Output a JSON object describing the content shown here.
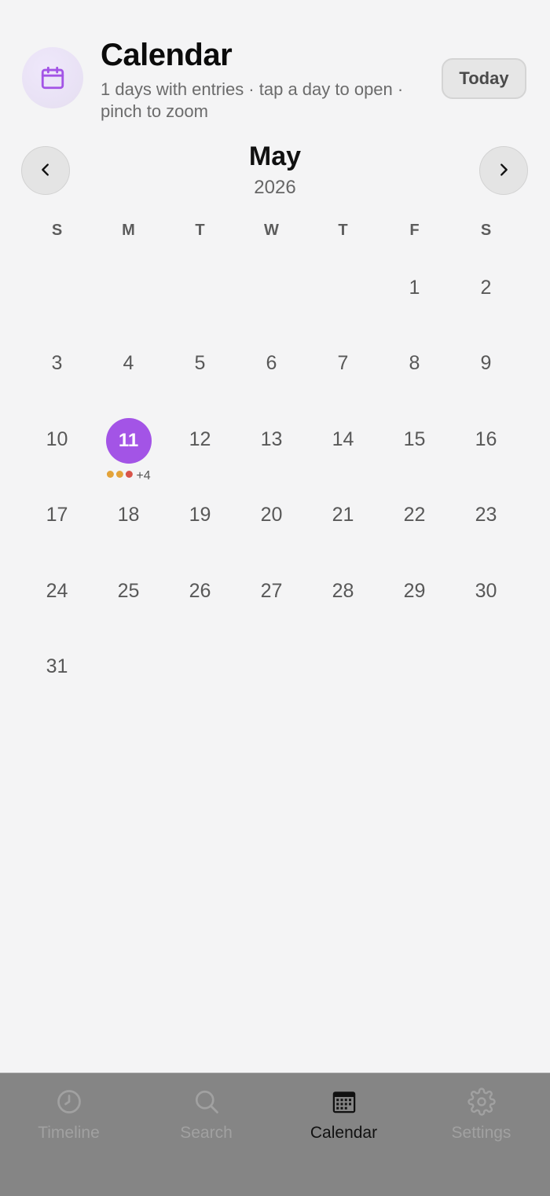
{
  "header": {
    "title": "Calendar",
    "subtitle": "1 days with entries · tap a day to open · pinch to zoom",
    "today_label": "Today",
    "icon": "calendar-icon"
  },
  "navigation": {
    "month": "May",
    "year": "2026",
    "prev_icon": "chevron-left-icon",
    "next_icon": "chevron-right-icon"
  },
  "weekdays": [
    "S",
    "M",
    "T",
    "W",
    "T",
    "F",
    "S"
  ],
  "calendar": {
    "leading_blanks": 5,
    "days": [
      "1",
      "2",
      "3",
      "4",
      "5",
      "6",
      "7",
      "8",
      "9",
      "10",
      "11",
      "12",
      "13",
      "14",
      "15",
      "16",
      "17",
      "18",
      "19",
      "20",
      "21",
      "22",
      "23",
      "24",
      "25",
      "26",
      "27",
      "28",
      "29",
      "30",
      "31"
    ],
    "selected_day": "11",
    "entry_day": {
      "day": "11",
      "dot_colors": [
        "#e3a33a",
        "#e3a33a",
        "#d8544a"
      ],
      "more_label": "+4"
    }
  },
  "colors": {
    "accent": "#a354e6",
    "background": "#f4f4f5",
    "tabbar": "#858585"
  },
  "tabs": [
    {
      "label": "Timeline",
      "icon": "clock-icon",
      "active": false
    },
    {
      "label": "Search",
      "icon": "search-icon",
      "active": false
    },
    {
      "label": "Calendar",
      "icon": "calendar-grid-icon",
      "active": true
    },
    {
      "label": "Settings",
      "icon": "gear-icon",
      "active": false
    }
  ]
}
